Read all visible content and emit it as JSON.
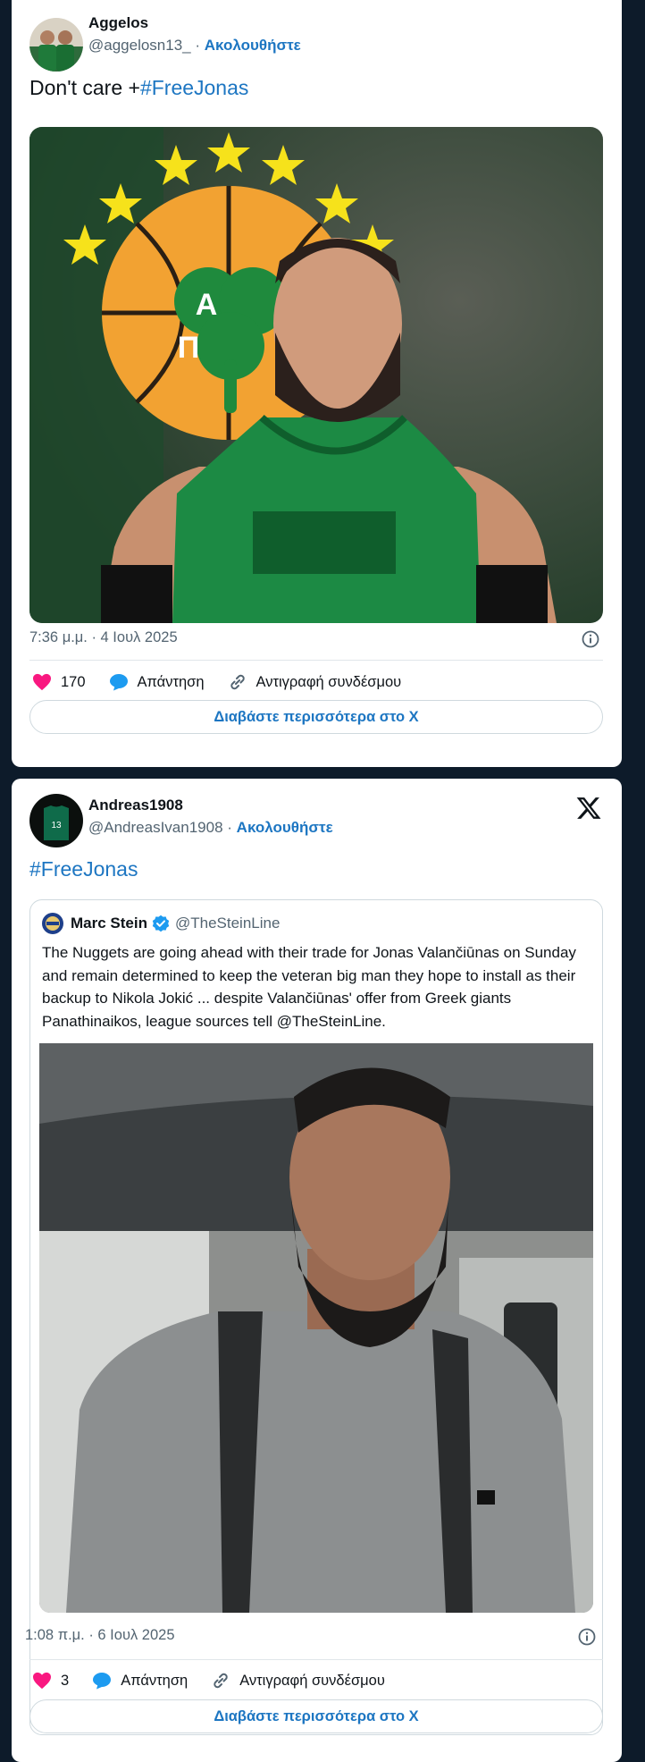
{
  "tweets": [
    {
      "name": "Aggelos",
      "handle": "@aggelosn13_",
      "separator": "·",
      "follow": "Ακολουθήστε",
      "text_prefix": "Don't care +",
      "hashtag": "#FreeJonas",
      "time": "7:36 μ.μ. · 4 Ιουλ 2025",
      "likes": "170",
      "reply": "Απάντηση",
      "copy_link": "Αντιγραφή συνδέσμου",
      "read_more": "Διαβάστε περισσότερα στο X",
      "media": {
        "logo_letters": [
          "Π",
          "Α"
        ]
      }
    },
    {
      "name": "Andreas1908",
      "handle": "@AndreasIvan1908",
      "separator": "·",
      "follow": "Ακολουθήστε",
      "hashtag": "#FreeJonas",
      "time": "1:08 π.μ. · 6 Ιουλ 2025",
      "likes": "3",
      "reply": "Απάντηση",
      "copy_link": "Αντιγραφή συνδέσμου",
      "read_more": "Διαβάστε περισσότερα στο X",
      "quote": {
        "name": "Marc Stein",
        "handle": "@TheSteinLine",
        "text": "The Nuggets are going ahead with their trade for Jonas Valančiūnas on Sunday and remain determined to keep the veteran big man they hope to install as their backup to Nikola Jokić ... despite Valančiūnas' offer from Greek giants Panathinaikos, league sources tell @TheSteinLine."
      }
    }
  ],
  "colors": {
    "accent": "#1d76c2",
    "like": "#f91880",
    "reply": "#1d9bf0",
    "verified": "#1d9bf0",
    "page_bg": "#0d1b2a"
  },
  "icons": [
    "heart-icon",
    "reply-bubble-icon",
    "link-icon",
    "info-icon",
    "x-logo-icon",
    "verified-badge-icon"
  ]
}
